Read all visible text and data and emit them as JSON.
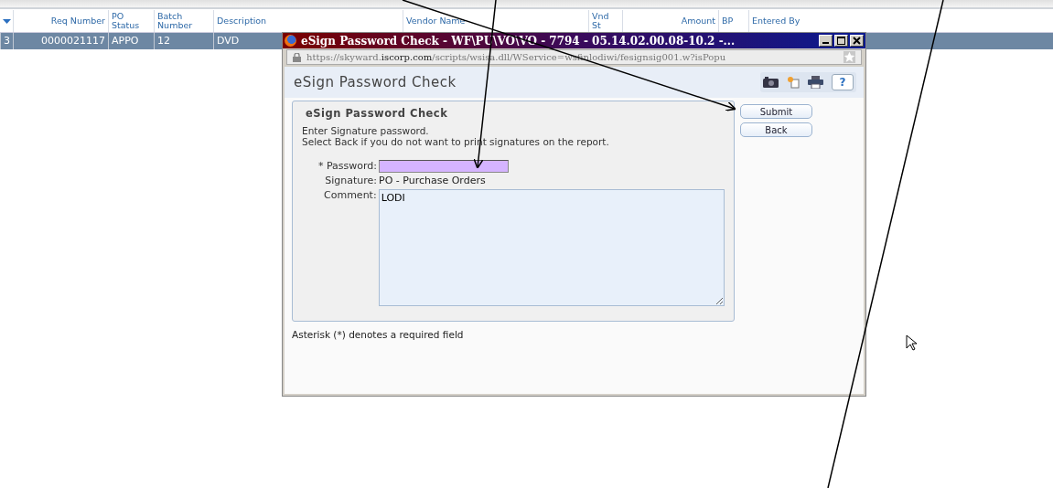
{
  "table": {
    "columns": [
      "Req Number",
      "PO Status",
      "Batch Number",
      "Description",
      "Vendor Name",
      "Vnd St",
      "Amount",
      "BP",
      "Entered By"
    ],
    "rows": [
      {
        "selected": true,
        "column_0": "3",
        "cells": [
          "0000021117",
          "APPO",
          "12",
          "DVD"
        ]
      }
    ]
  },
  "popup": {
    "title": "eSign Password Check - WF\\PU\\VO\\VO - 7794 - 05.14.02.00.08-10.2 -...",
    "url": "https://skyward.**iscorp.com**/scripts/wsisa.dll/WService=wsfinlodiwi/fesignsig001.w?isPopu",
    "header": "eSign Password Check",
    "panel_title": "eSign Password Check",
    "instructions": [
      "Enter Signature password.",
      "Select Back if you do not want to print signatures on the report."
    ],
    "help_label": "?",
    "fields": [
      {
        "kind": "input",
        "label": "* Password:"
      },
      {
        "kind": "text",
        "label": "Signature:",
        "value": "PO - Purchase Orders"
      },
      {
        "kind": "textarea",
        "label": "Comment:",
        "value": "LODI"
      }
    ],
    "buttons": [
      "Submit",
      "Back"
    ],
    "footnote": "Asterisk (*) denotes a required field"
  }
}
